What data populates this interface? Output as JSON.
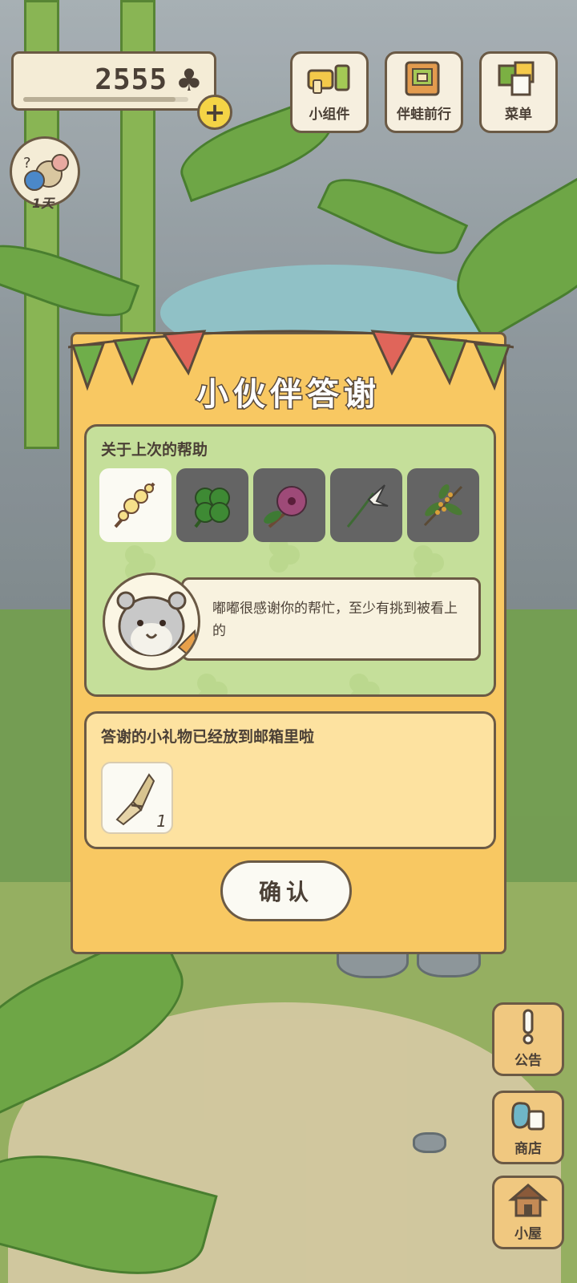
{
  "hud": {
    "clover_count": "2555",
    "clover_icon": "clover-icon",
    "add_label": "+",
    "widgets_label": "小组件",
    "travel_label": "伴蛙前行",
    "menu_label": "菜单",
    "day_label": "1天"
  },
  "dialog": {
    "title": "小伙伴答谢",
    "help_title": "关于上次的帮助",
    "help_items": [
      {
        "icon": "yellow-plum-blossom-icon",
        "selected": true
      },
      {
        "icon": "four-leaf-clover-icon",
        "selected": false
      },
      {
        "icon": "hibiscus-flower-icon",
        "selected": false
      },
      {
        "icon": "white-lily-icon",
        "selected": false
      },
      {
        "icon": "osmanthus-branch-icon",
        "selected": false
      }
    ],
    "speech": "嘟嘟很感谢你的帮忙，至少有挑到被看上的",
    "gift_title": "答谢的小礼物已经放到邮箱里啦",
    "gift_icon": "straw-bundle-icon",
    "gift_count": "1",
    "confirm_label": "确认"
  },
  "side_buttons": {
    "notice_label": "公告",
    "shop_label": "商店",
    "house_label": "小屋"
  },
  "colors": {
    "dialog_bg": "#f8c862",
    "help_panel_bg": "#c5df9a",
    "gift_panel_bg": "#fde2a0",
    "outline": "#6b5a45",
    "text": "#4b4036",
    "bunting_green": "#6fae4a",
    "bunting_red": "#e0655a"
  }
}
